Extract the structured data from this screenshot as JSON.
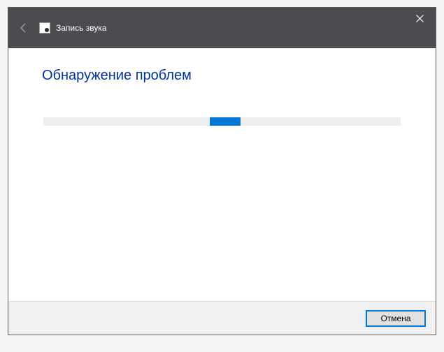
{
  "titlebar": {
    "title": "Запись звука"
  },
  "content": {
    "heading": "Обнаружение проблем"
  },
  "footer": {
    "cancel_label": "Отмена"
  }
}
